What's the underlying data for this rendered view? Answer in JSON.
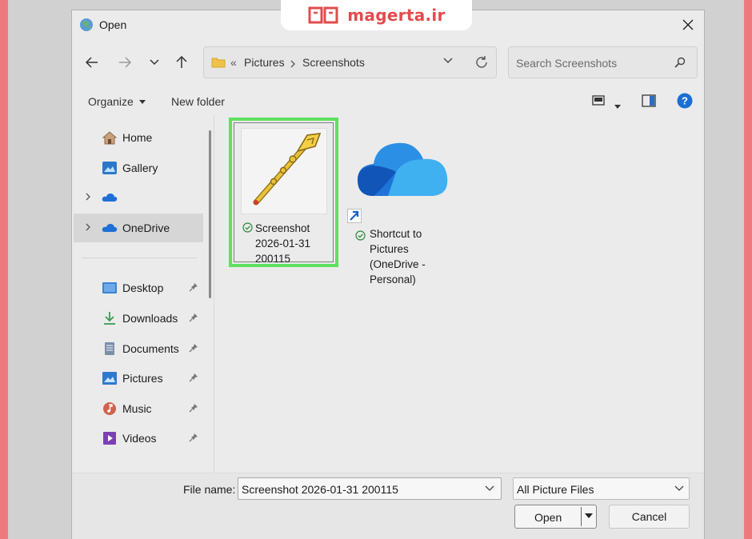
{
  "watermark": {
    "text": "magerta.ir"
  },
  "window": {
    "title": "Open",
    "close": "✕"
  },
  "navigation": {
    "back": "back",
    "forward": "forward",
    "recent": "recent-locations",
    "up": "up",
    "breadcrumb_overflow": "«",
    "path": [
      "Pictures",
      "Screenshots"
    ]
  },
  "search": {
    "placeholder": "Search Screenshots"
  },
  "toolbar": {
    "organize_label": "Organize",
    "new_folder_label": "New folder"
  },
  "sidebar": {
    "items": [
      {
        "label": "Home",
        "icon": "home-icon"
      },
      {
        "label": "Gallery",
        "icon": "gallery-icon"
      },
      {
        "label": "",
        "icon": "onedrive-cloud-icon"
      },
      {
        "label": "OneDrive",
        "icon": "onedrive-cloud-icon"
      },
      {
        "label": "Desktop",
        "icon": "desktop-icon"
      },
      {
        "label": "Downloads",
        "icon": "download-icon"
      },
      {
        "label": "Documents",
        "icon": "documents-icon"
      },
      {
        "label": "Pictures",
        "icon": "pictures-icon"
      },
      {
        "label": "Music",
        "icon": "music-icon"
      },
      {
        "label": "Videos",
        "icon": "videos-icon"
      }
    ]
  },
  "files": [
    {
      "name_lines": [
        "Screenshot",
        "2026-01-31",
        "200115"
      ],
      "selected": true,
      "thumbnail": "golden-pen-icon"
    },
    {
      "name_lines": [
        "Shortcut to",
        "Pictures",
        "(OneDrive -",
        "Personal)"
      ],
      "selected": false,
      "thumbnail": "onedrive-cloud-icon"
    }
  ],
  "footer": {
    "file_name_label": "File name:",
    "file_name_value": "Screenshot 2026-01-31 200115",
    "file_type": "All Picture Files",
    "open_label": "Open",
    "cancel_label": "Cancel"
  },
  "colors": {
    "watermark": "#e34b4e",
    "selection_highlight": "#5fe05f",
    "outer_border": "#ee7a7d",
    "help_icon": "#1b6fd1"
  }
}
